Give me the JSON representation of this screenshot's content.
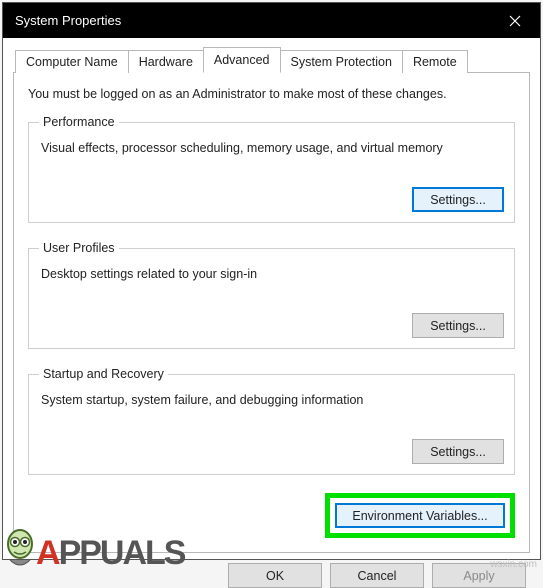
{
  "window": {
    "title": "System Properties"
  },
  "tabs": [
    {
      "label": "Computer Name"
    },
    {
      "label": "Hardware"
    },
    {
      "label": "Advanced"
    },
    {
      "label": "System Protection"
    },
    {
      "label": "Remote"
    }
  ],
  "active_tab": 2,
  "advanced": {
    "intro": "You must be logged on as an Administrator to make most of these changes.",
    "performance": {
      "legend": "Performance",
      "desc": "Visual effects, processor scheduling, memory usage, and virtual memory",
      "settings_btn": "Settings..."
    },
    "user_profiles": {
      "legend": "User Profiles",
      "desc": "Desktop settings related to your sign-in",
      "settings_btn": "Settings..."
    },
    "startup": {
      "legend": "Startup and Recovery",
      "desc": "System startup, system failure, and debugging information",
      "settings_btn": "Settings..."
    },
    "env_btn": "Environment Variables..."
  },
  "buttons": {
    "ok": "OK",
    "cancel": "Cancel",
    "apply": "Apply"
  },
  "watermark": "wsxin.com",
  "brand": {
    "text_a": "A",
    "text_ppuals": "PPUALS"
  }
}
